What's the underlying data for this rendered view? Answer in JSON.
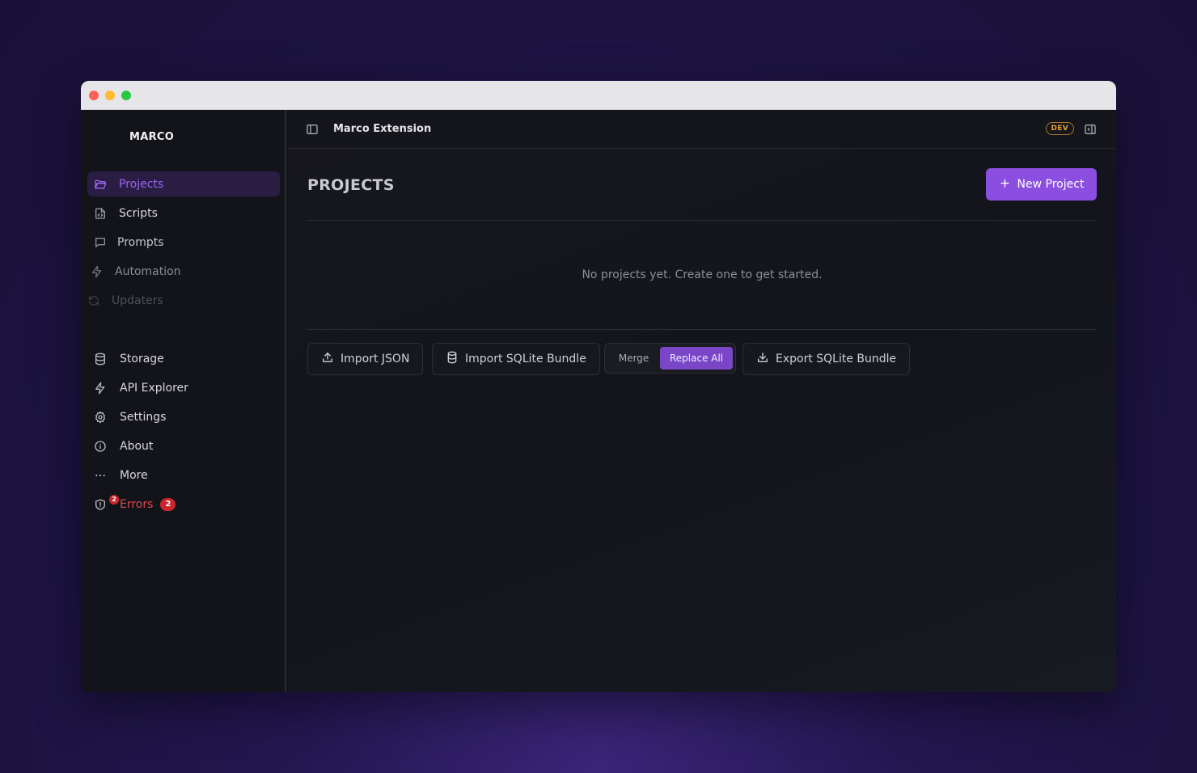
{
  "sidebar": {
    "brand": "MARCO",
    "primary_items": [
      {
        "label": "Projects",
        "icon": "folder-icon"
      },
      {
        "label": "Scripts",
        "icon": "file-code-icon"
      },
      {
        "label": "Prompts",
        "icon": "message-square-icon"
      },
      {
        "label": "Automation",
        "icon": "bolt-icon"
      },
      {
        "label": "Updaters",
        "icon": "refresh-icon"
      }
    ],
    "secondary_items": [
      {
        "label": "Storage",
        "icon": "database-icon"
      },
      {
        "label": "API Explorer",
        "icon": "bolt-icon"
      },
      {
        "label": "Settings",
        "icon": "gear-icon"
      },
      {
        "label": "About",
        "icon": "info-icon"
      },
      {
        "label": "More",
        "icon": "ellipsis-icon"
      },
      {
        "label": "Errors",
        "icon": "shield-alert-icon",
        "count": "2",
        "icon_count": "2"
      }
    ]
  },
  "topbar": {
    "title": "Marco Extension",
    "badge": "DEV"
  },
  "main": {
    "title": "PROJECTS",
    "new_button": "New Project",
    "empty_message": "No projects yet. Create one to get started.",
    "actions": {
      "import_json": "Import JSON",
      "import_sqlite": "Import SQLite Bundle",
      "merge": "Merge",
      "replace_all": "Replace All",
      "export_sqlite": "Export SQLite Bundle"
    },
    "import_mode_selected": "Replace All"
  },
  "colors": {
    "accent": "#8b4ee0",
    "active_nav_bg": "#2a1d44",
    "active_nav_text": "#9a67f0",
    "error": "#e0474c",
    "dev_badge": "#e0a032"
  }
}
